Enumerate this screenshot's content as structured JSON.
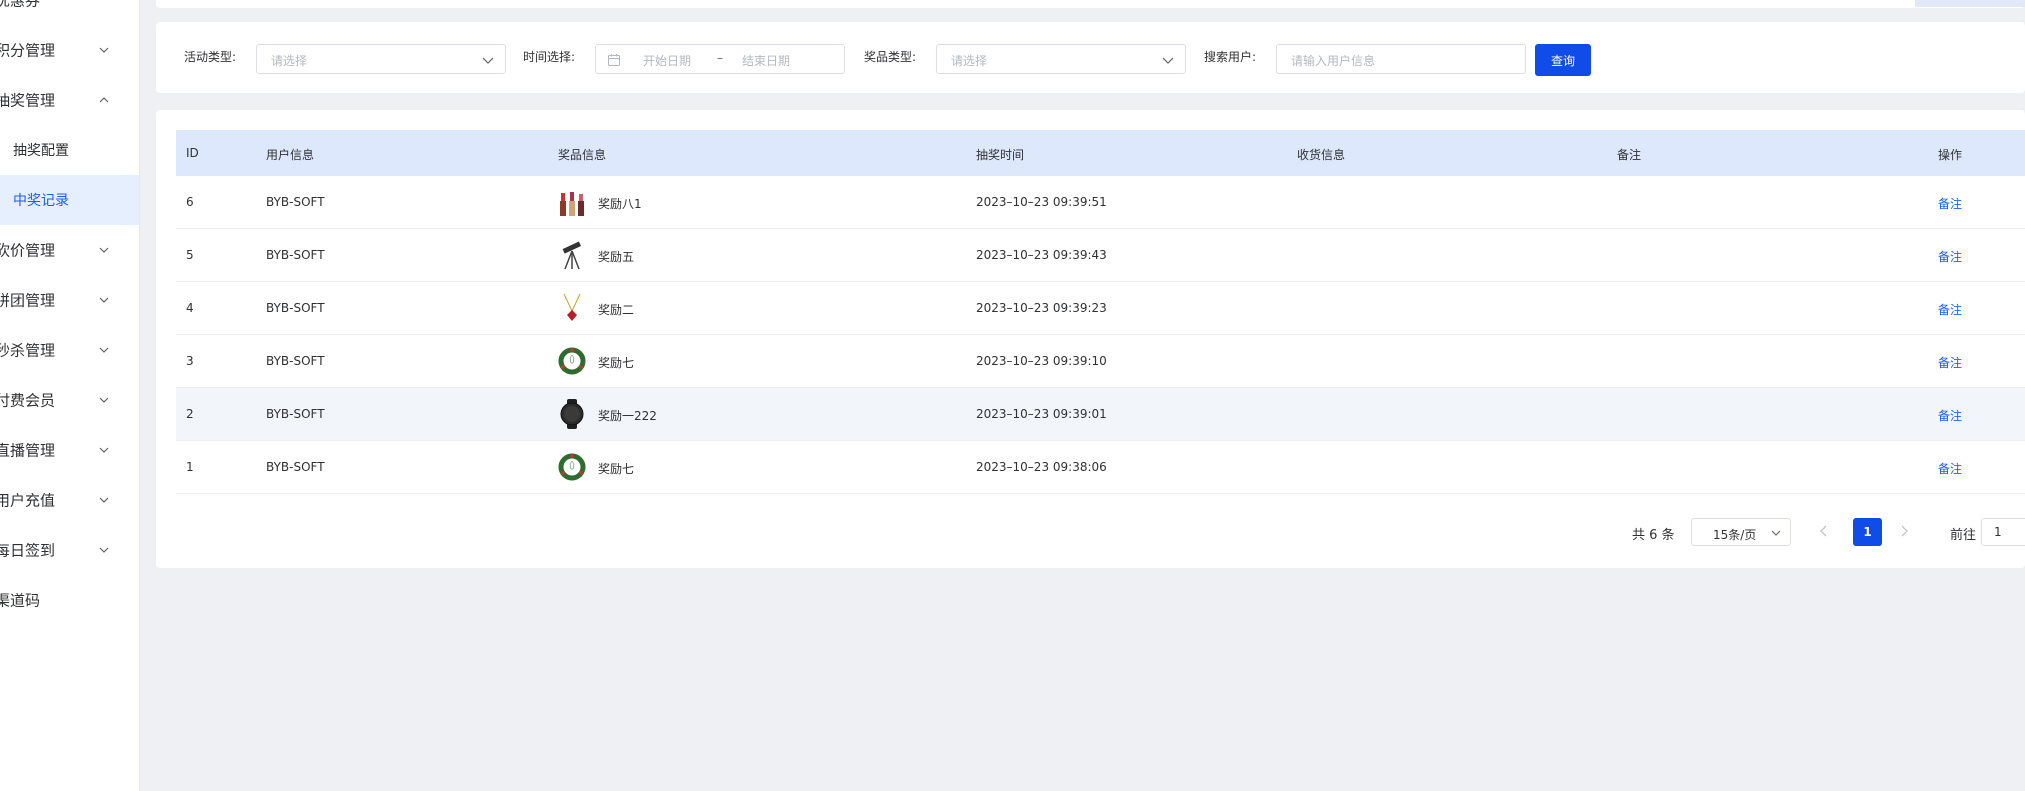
{
  "sidebar": {
    "items": [
      {
        "label": "优惠券",
        "chevron": "none"
      },
      {
        "label": "积分管理",
        "chevron": "down"
      },
      {
        "label": "抽奖管理",
        "chevron": "up"
      },
      {
        "label": "抽奖配置",
        "chevron": "none"
      },
      {
        "label": "中奖记录",
        "chevron": "none"
      },
      {
        "label": "砍价管理",
        "chevron": "down"
      },
      {
        "label": "拼团管理",
        "chevron": "down"
      },
      {
        "label": "秒杀管理",
        "chevron": "down"
      },
      {
        "label": "付费会员",
        "chevron": "down"
      },
      {
        "label": "直播管理",
        "chevron": "down"
      },
      {
        "label": "用户充值",
        "chevron": "down"
      },
      {
        "label": "每日签到",
        "chevron": "down"
      },
      {
        "label": "渠道码",
        "chevron": "none"
      }
    ]
  },
  "filters": {
    "activity_type": {
      "label": "活动类型:",
      "placeholder": "请选择"
    },
    "time": {
      "label": "时间选择:",
      "start_placeholder": "开始日期",
      "separator": "–",
      "end_placeholder": "结束日期"
    },
    "prize_type": {
      "label": "奖品类型:",
      "placeholder": "请选择"
    },
    "user": {
      "label": "搜索用户:",
      "placeholder": "请输入用户信息"
    },
    "search_button": "查询"
  },
  "table": {
    "columns": {
      "id": "ID",
      "user": "用户信息",
      "prize": "奖品信息",
      "time": "抽奖时间",
      "shipping": "收货信息",
      "remark": "备注",
      "action": "操作"
    },
    "rows": [
      {
        "id": "6",
        "user": "BYB-SOFT",
        "prize": "奖励八1",
        "prize_icon": "lipstick-icon",
        "time": "2023–10–23 09:39:51",
        "shipping": "",
        "remark": "",
        "action": "备注"
      },
      {
        "id": "5",
        "user": "BYB-SOFT",
        "prize": "奖励五",
        "prize_icon": "telescope-icon",
        "time": "2023–10–23 09:39:43",
        "shipping": "",
        "remark": "",
        "action": "备注"
      },
      {
        "id": "4",
        "user": "BYB-SOFT",
        "prize": "奖励二",
        "prize_icon": "necklace-icon",
        "time": "2023–10–23 09:39:23",
        "shipping": "",
        "remark": "",
        "action": "备注"
      },
      {
        "id": "3",
        "user": "BYB-SOFT",
        "prize": "奖励七",
        "prize_icon": "wreath-icon",
        "time": "2023–10–23 09:39:10",
        "shipping": "",
        "remark": "",
        "action": "备注"
      },
      {
        "id": "2",
        "user": "BYB-SOFT",
        "prize": "奖励一222",
        "prize_icon": "smartwatch-icon",
        "time": "2023–10–23 09:39:01",
        "shipping": "",
        "remark": "",
        "action": "备注"
      },
      {
        "id": "1",
        "user": "BYB-SOFT",
        "prize": "奖励七",
        "prize_icon": "wreath-icon",
        "time": "2023–10–23 09:38:06",
        "shipping": "",
        "remark": "",
        "action": "备注"
      }
    ]
  },
  "pagination": {
    "total": "共 6 条",
    "page_size": "15条/页",
    "current_page": "1",
    "goto_label": "前往",
    "goto_value": "1"
  },
  "colors": {
    "primary": "#0f4ce8",
    "link": "#1c5ef2",
    "table_header_bg": "#dde8fd",
    "active_menu_bg": "#e6effe"
  }
}
